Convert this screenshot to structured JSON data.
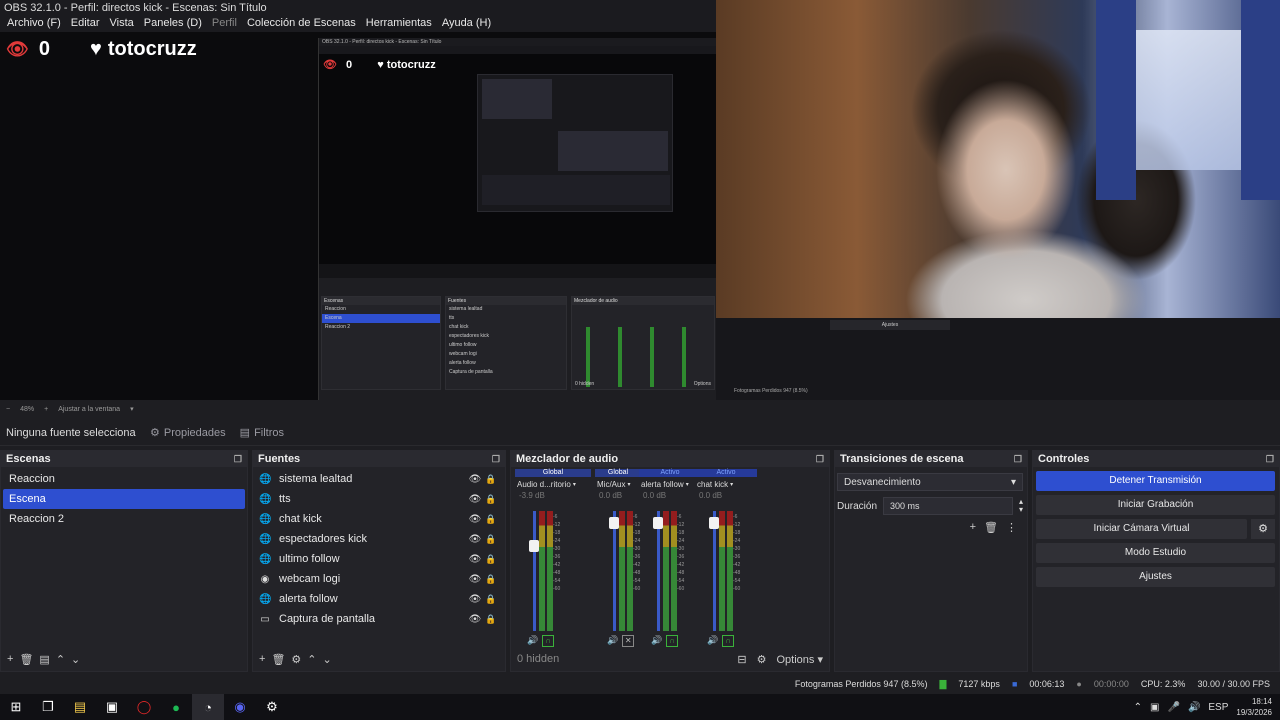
{
  "window": {
    "title": "OBS 32.1.0 - Perfil: directos kick - Escenas: Sin Título"
  },
  "menu": [
    {
      "label": "Archivo (F)",
      "dim": false
    },
    {
      "label": "Editar",
      "dim": false
    },
    {
      "label": "Vista",
      "dim": false
    },
    {
      "label": "Paneles (D)",
      "dim": false
    },
    {
      "label": "Perfil",
      "dim": true
    },
    {
      "label": "Colección de Escenas",
      "dim": false
    },
    {
      "label": "Herramientas",
      "dim": false
    },
    {
      "label": "Ayuda (H)",
      "dim": false
    }
  ],
  "overlay": {
    "viewer_count": "0",
    "channel": "totocruzz"
  },
  "nested": {
    "title": "OBS 32.1.0 - Perfil: directos kick - Escenas: Sin Título",
    "viewer_count": "0",
    "channel": "totocruzz",
    "scenes": [
      "Reaccion",
      "Escena",
      "Reaccion 2"
    ],
    "sources": [
      "sistema lealtad",
      "tts",
      "chat kick",
      "espectadores kick",
      "ultimo follow",
      "webcam logi",
      "alerta follow",
      "Captura de pantalla"
    ],
    "hidden": "0 hidden",
    "options": "Options",
    "mini_status": "Fotogramas Perdidos 947 (8.5%)",
    "adjust": "Ajustes"
  },
  "zoom": {
    "percent": "48%",
    "fit_label": "Ajustar a la ventana"
  },
  "source_toolbar": {
    "no_source": "Ninguna fuente seleccionada",
    "properties": "Propiedades",
    "filters": "Filtros"
  },
  "scenes": {
    "title": "Escenas",
    "items": [
      {
        "label": "Reaccion",
        "active": false
      },
      {
        "label": "Escena",
        "active": true
      },
      {
        "label": "Reaccion 2",
        "active": false
      }
    ]
  },
  "sources": {
    "title": "Fuentes",
    "items": [
      {
        "label": "sistema lealtad",
        "icon": "globe-icon"
      },
      {
        "label": "tts",
        "icon": "globe-icon"
      },
      {
        "label": "chat kick",
        "icon": "globe-icon"
      },
      {
        "label": "espectadores kick",
        "icon": "globe-icon"
      },
      {
        "label": "ultimo follow",
        "icon": "globe-icon"
      },
      {
        "label": "webcam logi",
        "icon": "camera-icon"
      },
      {
        "label": "alerta follow",
        "icon": "globe-icon"
      },
      {
        "label": "Captura de pantalla",
        "icon": "monitor-icon"
      }
    ]
  },
  "mixer": {
    "title": "Mezclador de audio",
    "channels": [
      {
        "badge": "Global",
        "badge_active": false,
        "name": "Audio d...ritorio",
        "db": "-3.9 dB",
        "level": 0.74,
        "headphone_on": true
      },
      {
        "badge": "Global",
        "badge_active": false,
        "name": "Mic/Aux",
        "db": "0.0 dB",
        "level": 0.95,
        "headphone_on": false
      },
      {
        "badge": "Activo",
        "badge_active": true,
        "name": "alerta follow",
        "db": "0.0 dB",
        "level": 0.95,
        "headphone_on": true
      },
      {
        "badge": "Activo",
        "badge_active": true,
        "name": "chat kick",
        "db": "0.0 dB",
        "level": 0.95,
        "headphone_on": true
      }
    ],
    "scale": [
      "-6",
      "-12",
      "-18",
      "-24",
      "-30",
      "-36",
      "-42",
      "-48",
      "-54",
      "-60"
    ],
    "hidden_label": "0 hidden",
    "options_label": "Options"
  },
  "transitions": {
    "title": "Transiciones de escena",
    "selected": "Desvanecimiento",
    "duration_label": "Duración",
    "duration_value": "300 ms"
  },
  "controls": {
    "title": "Controles",
    "stop_stream": "Detener Transmisión",
    "start_recording": "Iniciar Grabación",
    "start_virtual_cam": "Iniciar Cámara Virtual",
    "studio_mode": "Modo Estudio",
    "settings": "Ajustes"
  },
  "status": {
    "dropped_frames": "Fotogramas Perdidos 947 (8.5%)",
    "bitrate": "7127 kbps",
    "stream_time": "00:06:13",
    "rec_time": "00:00:00",
    "cpu": "CPU: 2.3%",
    "fps": "30.00 / 30.00 FPS"
  },
  "taskbar": {
    "icons": [
      "windows-icon",
      "task-view-icon",
      "file-explorer-icon",
      "store-icon",
      "opera-icon",
      "spotify-icon",
      "obs-icon",
      "discord-icon",
      "settings-icon"
    ],
    "language": "ESP",
    "time": "18:14",
    "date": "19/3/2026"
  },
  "colors": {
    "accent": "#2e4fd0",
    "panel": "#232328",
    "background": "#1e1e22",
    "live": "#e23a3a"
  }
}
